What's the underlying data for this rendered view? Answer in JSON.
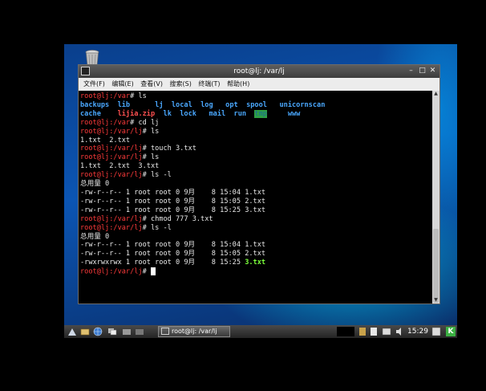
{
  "window": {
    "title": "root@lj: /var/lj",
    "controls": {
      "minimize": "–",
      "maximize": "□",
      "close": "✕"
    }
  },
  "menubar": {
    "items": [
      "文件(F)",
      "编辑(E)",
      "查看(V)",
      "搜索(S)",
      "终端(T)",
      "帮助(H)"
    ]
  },
  "terminal": {
    "lines": [
      {
        "segs": [
          {
            "t": "root@lj:/var",
            "c": "red"
          },
          {
            "t": "# ls",
            "c": ""
          }
        ]
      },
      {
        "segs": [
          {
            "t": "backups",
            "c": "blue"
          },
          {
            "t": "  ",
            "c": ""
          },
          {
            "t": "lib",
            "c": "blue"
          },
          {
            "t": "      ",
            "c": ""
          },
          {
            "t": "lj",
            "c": "blue"
          },
          {
            "t": "  ",
            "c": ""
          },
          {
            "t": "local",
            "c": "blue"
          },
          {
            "t": "  ",
            "c": ""
          },
          {
            "t": "log",
            "c": "blue"
          },
          {
            "t": "   ",
            "c": ""
          },
          {
            "t": "opt",
            "c": "blue"
          },
          {
            "t": "  ",
            "c": ""
          },
          {
            "t": "spool",
            "c": "blue"
          },
          {
            "t": "   ",
            "c": ""
          },
          {
            "t": "unicornscan",
            "c": "blue"
          }
        ]
      },
      {
        "segs": [
          {
            "t": "cache",
            "c": "blue"
          },
          {
            "t": "    ",
            "c": ""
          },
          {
            "t": "lijia.zip",
            "c": "redfile"
          },
          {
            "t": "  ",
            "c": ""
          },
          {
            "t": "lk",
            "c": "blue"
          },
          {
            "t": "  ",
            "c": ""
          },
          {
            "t": "lock",
            "c": "blue"
          },
          {
            "t": "   ",
            "c": ""
          },
          {
            "t": "mail",
            "c": "blue"
          },
          {
            "t": "  ",
            "c": ""
          },
          {
            "t": "run",
            "c": "blue"
          },
          {
            "t": "  ",
            "c": ""
          },
          {
            "t": "tmp",
            "c": "hl"
          },
          {
            "t": "     ",
            "c": ""
          },
          {
            "t": "www",
            "c": "blue"
          }
        ]
      },
      {
        "segs": [
          {
            "t": "root@lj:/var",
            "c": "red"
          },
          {
            "t": "# cd lj",
            "c": ""
          }
        ]
      },
      {
        "segs": [
          {
            "t": "root@lj:/var/lj",
            "c": "red"
          },
          {
            "t": "# ls",
            "c": ""
          }
        ]
      },
      {
        "segs": [
          {
            "t": "1.txt  2.txt",
            "c": ""
          }
        ]
      },
      {
        "segs": [
          {
            "t": "root@lj:/var/lj",
            "c": "red"
          },
          {
            "t": "# touch 3.txt",
            "c": ""
          }
        ]
      },
      {
        "segs": [
          {
            "t": "root@lj:/var/lj",
            "c": "red"
          },
          {
            "t": "# ls",
            "c": ""
          }
        ]
      },
      {
        "segs": [
          {
            "t": "1.txt  2.txt  3.txt",
            "c": ""
          }
        ]
      },
      {
        "segs": [
          {
            "t": "root@lj:/var/lj",
            "c": "red"
          },
          {
            "t": "# ls -l",
            "c": ""
          }
        ]
      },
      {
        "segs": [
          {
            "t": "总用量 0",
            "c": ""
          }
        ]
      },
      {
        "segs": [
          {
            "t": "-rw-r--r-- 1 root root 0 9月    8 15:04 1.txt",
            "c": ""
          }
        ]
      },
      {
        "segs": [
          {
            "t": "-rw-r--r-- 1 root root 0 9月    8 15:05 2.txt",
            "c": ""
          }
        ]
      },
      {
        "segs": [
          {
            "t": "-rw-r--r-- 1 root root 0 9月    8 15:25 3.txt",
            "c": ""
          }
        ]
      },
      {
        "segs": [
          {
            "t": "root@lj:/var/lj",
            "c": "red"
          },
          {
            "t": "# chmod 777 3.txt",
            "c": ""
          }
        ]
      },
      {
        "segs": [
          {
            "t": "root@lj:/var/lj",
            "c": "red"
          },
          {
            "t": "# ls -l",
            "c": ""
          }
        ]
      },
      {
        "segs": [
          {
            "t": "总用量 0",
            "c": ""
          }
        ]
      },
      {
        "segs": [
          {
            "t": "-rw-r--r-- 1 root root 0 9月    8 15:04 1.txt",
            "c": ""
          }
        ]
      },
      {
        "segs": [
          {
            "t": "-rw-r--r-- 1 root root 0 9月    8 15:05 2.txt",
            "c": ""
          }
        ]
      },
      {
        "segs": [
          {
            "t": "-rwxrwxrwx 1 root root 0 9月    8 15:25 ",
            "c": ""
          },
          {
            "t": "3.txt",
            "c": "green"
          }
        ]
      },
      {
        "segs": [
          {
            "t": "root@lj:/var/lj",
            "c": "red"
          },
          {
            "t": "# ",
            "c": ""
          }
        ],
        "cursor": true
      }
    ]
  },
  "taskbar": {
    "task_label": "root@lj: /var/lj",
    "clock": "15:29",
    "tray_label": "K"
  },
  "icons": {
    "trash": "trash-icon",
    "start": "start-menu-icon",
    "files": "file-manager-icon",
    "browser": "browser-icon",
    "desktop": "show-desktop-icon"
  }
}
